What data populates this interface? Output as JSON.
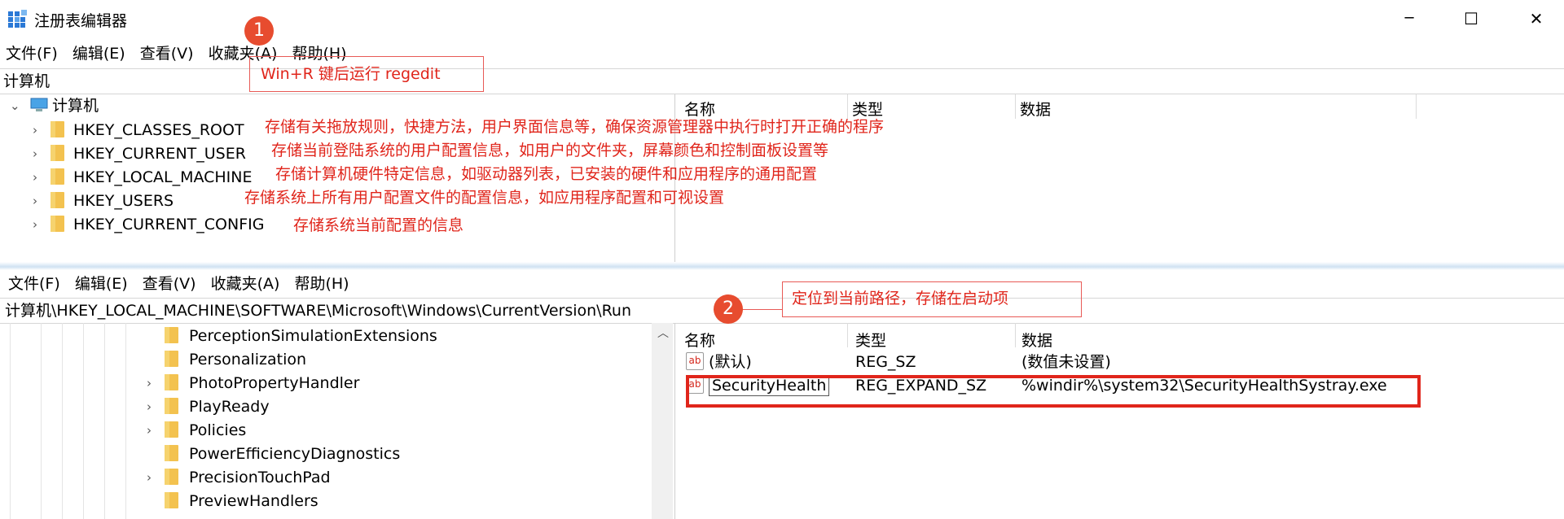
{
  "window": {
    "title": "注册表编辑器",
    "min": "─",
    "max": "☐",
    "close": "✕"
  },
  "menu_top": [
    "文件(F)",
    "编辑(E)",
    "查看(V)",
    "收藏夹(A)",
    "帮助(H)"
  ],
  "address_top": "计算机",
  "tree_top": {
    "root": "计算机",
    "items": [
      "HKEY_CLASSES_ROOT",
      "HKEY_CURRENT_USER",
      "HKEY_LOCAL_MACHINE",
      "HKEY_USERS",
      "HKEY_CURRENT_CONFIG"
    ]
  },
  "columns": {
    "name": "名称",
    "type": "类型",
    "data": "数据"
  },
  "annotations": {
    "step1_num": "1",
    "step1_text": "Win+R 键后运行 regedit",
    "hkcr": "存储有关拖放规则，快捷方法，用户界面信息等，确保资源管理器中执行时打开正确的程序",
    "hkcu": "存储当前登陆系统的用户配置信息，如用户的文件夹，屏幕颜色和控制面板设置等",
    "hklm": "存储计算机硬件特定信息，如驱动器列表，已安装的硬件和应用程序的通用配置",
    "hku": "存储系统上所有用户配置文件的配置信息，如应用程序配置和可视设置",
    "hkcc": "存储系统当前配置的信息",
    "step2_num": "2",
    "step2_text": "定位到当前路径，存储在启动项"
  },
  "menu_bottom": [
    "文件(F)",
    "编辑(E)",
    "查看(V)",
    "收藏夹(A)",
    "帮助(H)"
  ],
  "address_bottom": "计算机\\HKEY_LOCAL_MACHINE\\SOFTWARE\\Microsoft\\Windows\\CurrentVersion\\Run",
  "tree_bottom": [
    "PerceptionSimulationExtensions",
    "Personalization",
    "PhotoPropertyHandler",
    "PlayReady",
    "Policies",
    "PowerEfficiencyDiagnostics",
    "PrecisionTouchPad",
    "PreviewHandlers"
  ],
  "values": [
    {
      "icon": "ab",
      "name": "(默认)",
      "type": "REG_SZ",
      "data": "(数值未设置)"
    },
    {
      "icon": "ab",
      "name": "SecurityHealth",
      "type": "REG_EXPAND_SZ",
      "data": "%windir%\\system32\\SecurityHealthSystray.exe"
    }
  ],
  "colors": {
    "accent_red": "#e0251b",
    "folder": "#f3c24f"
  }
}
